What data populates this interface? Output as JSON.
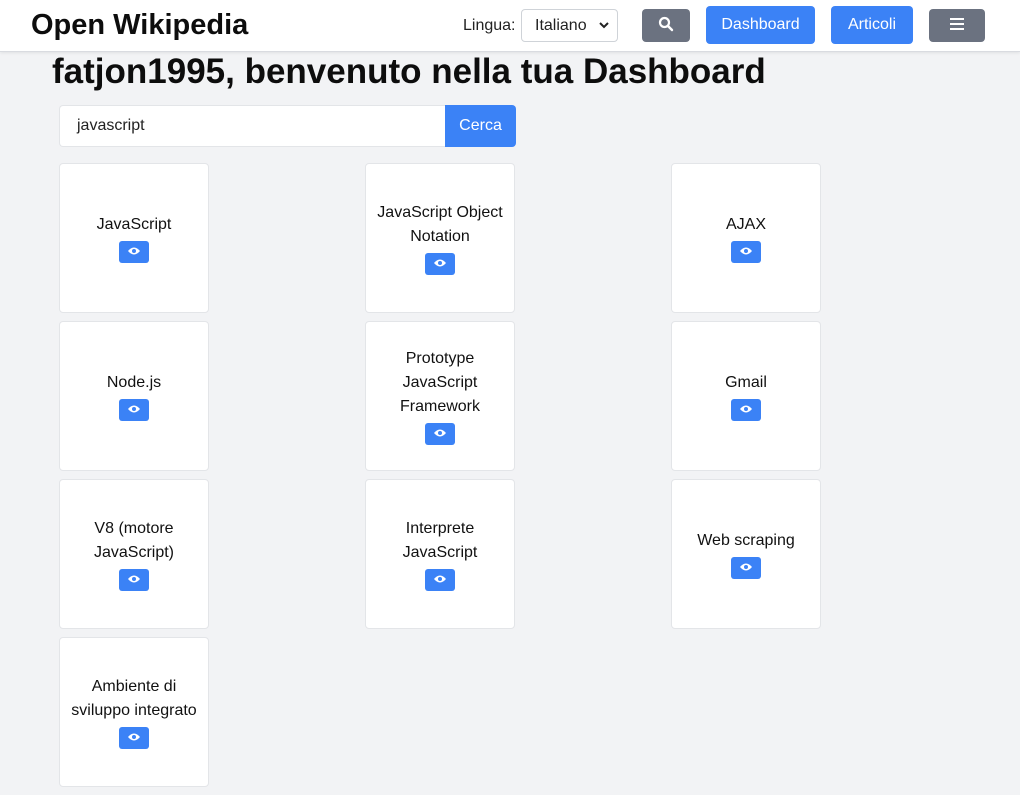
{
  "header": {
    "brand": "Open Wikipedia",
    "language_label": "Lingua:",
    "language_selected": "Italiano",
    "search_icon": "search-icon",
    "dashboard_label": "Dashboard",
    "articles_label": "Articoli",
    "menu_icon": "hamburger-menu-icon"
  },
  "welcome": "fatjon1995, benvenuto nella tua Dashboard",
  "search": {
    "value": "javascript",
    "button_label": "Cerca"
  },
  "results": [
    {
      "title": "JavaScript"
    },
    {
      "title": "JavaScript Object Notation"
    },
    {
      "title": "AJAX"
    },
    {
      "title": "Node.js"
    },
    {
      "title": "Prototype JavaScript Framework"
    },
    {
      "title": "Gmail"
    },
    {
      "title": "V8 (motore JavaScript)"
    },
    {
      "title": "Interprete JavaScript"
    },
    {
      "title": "Web scraping"
    },
    {
      "title": "Ambiente di sviluppo integrato"
    }
  ],
  "colors": {
    "accent": "#3b82f6",
    "secondary": "#6b7280",
    "background": "#f2f3f5"
  }
}
